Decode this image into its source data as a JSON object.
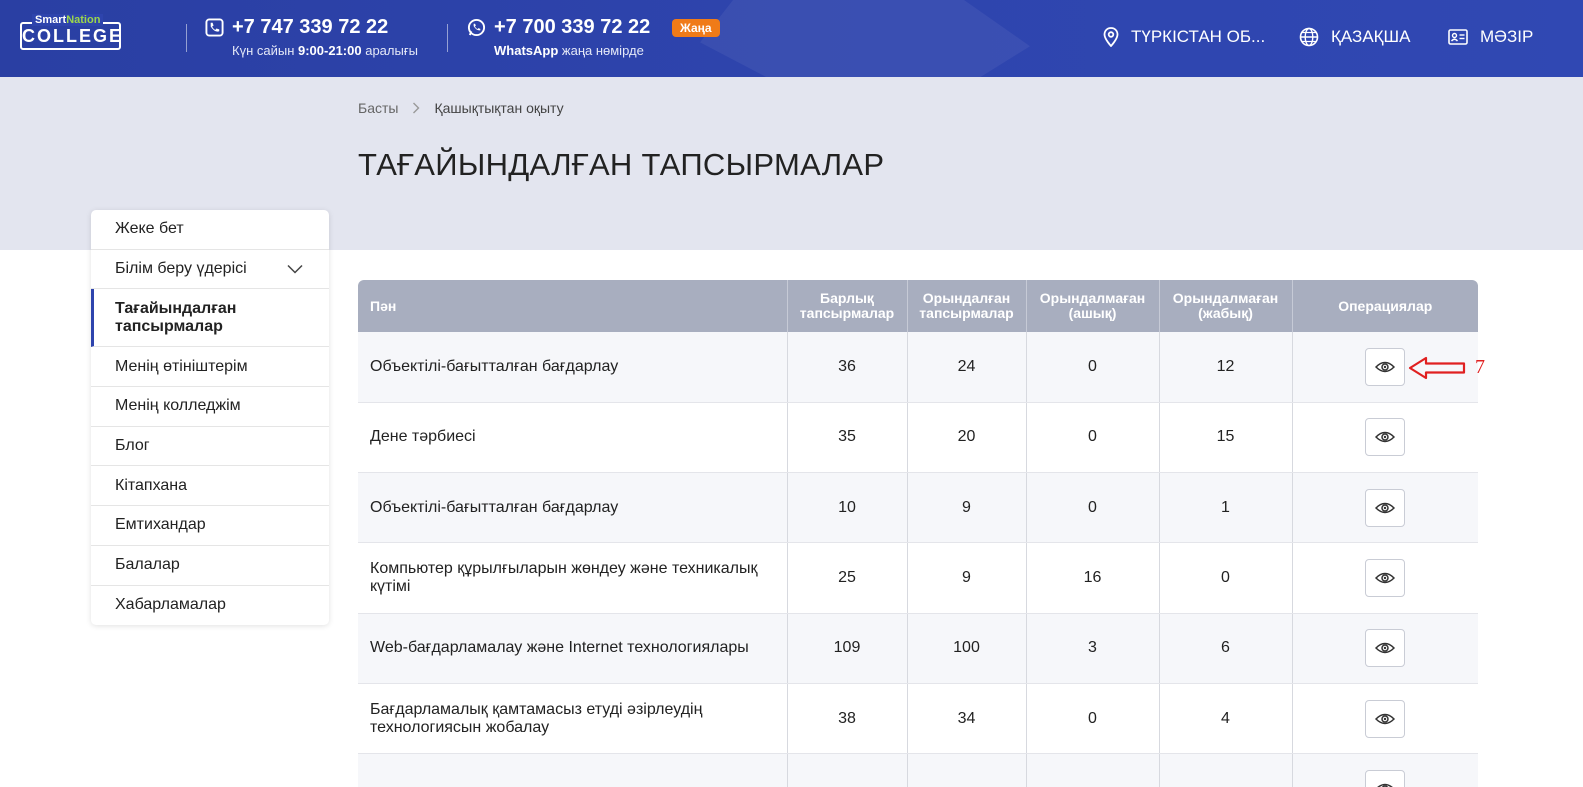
{
  "header": {
    "logo": {
      "smart": "Smart",
      "nation": "Nation",
      "college": "COLLEGE"
    },
    "phone1": {
      "number": "+7 747 339 72 22",
      "sub_prefix": "Күн сайын ",
      "sub_bold": "9:00-21:00",
      "sub_suffix": " аралығы"
    },
    "phone2": {
      "number": "+7 700 339 72 22",
      "sub_bold": "WhatsApp",
      "sub_suffix": " жаңа нөмірде"
    },
    "new_badge": "Жаңа",
    "region": "ТҮРКІСТАН ОБ...",
    "language": "ҚАЗАҚША",
    "menu": "МӘЗІР"
  },
  "breadcrumb": {
    "home": "Басты",
    "current": "Қашықтықтан оқыту"
  },
  "page_title": "ТАҒАЙЫНДАЛҒАН ТАПСЫРМАЛАР",
  "sidebar": {
    "items": [
      {
        "label": "Жеке бет"
      },
      {
        "label": "Білім беру үдерісі"
      },
      {
        "label": "Тағайындалған тапсырмалар"
      },
      {
        "label": "Менің өтініштерім"
      },
      {
        "label": "Менің колледжім"
      },
      {
        "label": "Блог"
      },
      {
        "label": "Кітапхана"
      },
      {
        "label": "Емтихандар"
      },
      {
        "label": "Балалар"
      },
      {
        "label": "Хабарламалар"
      }
    ]
  },
  "table": {
    "headers": [
      "Пән",
      "Барлық тапсырмалар",
      "Орындалған тапсырмалар",
      "Орындалмаған (ашық)",
      "Орындалмаған (жабық)",
      "Операциялар"
    ],
    "rows": [
      [
        "Объектілі-бағытталған бағдарлау",
        "36",
        "24",
        "0",
        "12"
      ],
      [
        "Дене тәрбиесі",
        "35",
        "20",
        "0",
        "15"
      ],
      [
        "Объектілі-бағытталған бағдарлау",
        "10",
        "9",
        "0",
        "1"
      ],
      [
        "Компьютер құрылғыларын жөндеу және техникалық күтімі",
        "25",
        "9",
        "16",
        "0"
      ],
      [
        "Web-бағдарламалау және Internet технологиялары",
        "109",
        "100",
        "3",
        "6"
      ],
      [
        "Бағдарламалық қамтамасыз етуді әзірлеудің технологиясын жобалау",
        "38",
        "34",
        "0",
        "4"
      ],
      [
        "",
        "",
        "",
        "",
        ""
      ]
    ]
  },
  "annotation": {
    "number": "7"
  },
  "colors": {
    "header": "#2e44ad",
    "accent_new": "#f07b18",
    "table_header": "#a8aebf",
    "annotation": "#e02020"
  }
}
